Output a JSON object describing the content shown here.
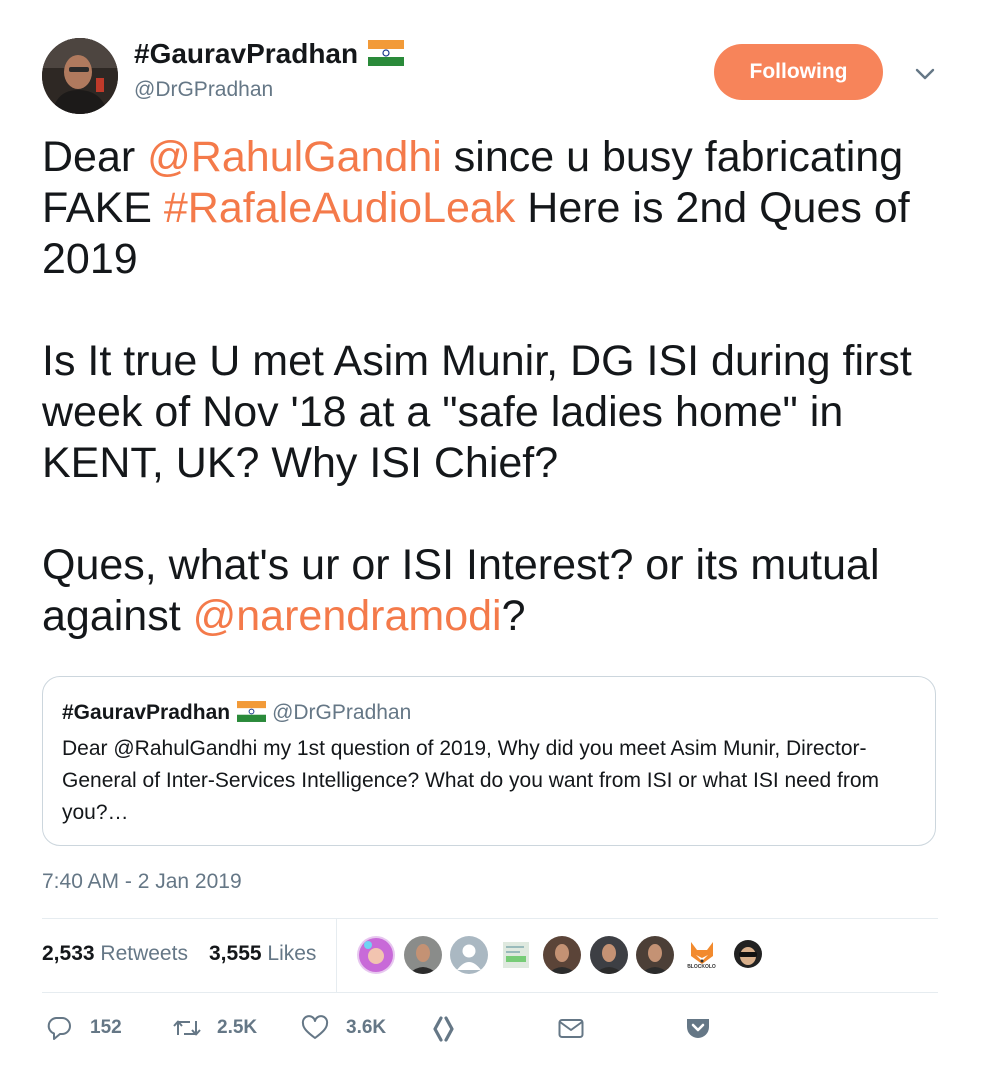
{
  "author": {
    "name": "#GauravPradhan",
    "handle": "@DrGPradhan",
    "flag_icon": "india-flag-icon"
  },
  "follow_button": {
    "label": "Following",
    "color": "#f7845a"
  },
  "menu_icon": "chevron-down-icon",
  "tweet": {
    "paragraphs": [
      [
        {
          "text": "Dear "
        },
        {
          "text": "@RahulGandhi",
          "link": true
        },
        {
          "text": " since u busy fabricating FAKE "
        },
        {
          "text": "#RafaleAudioLeak",
          "link": true
        },
        {
          "text": " Here is 2nd Ques of 2019"
        }
      ],
      [
        {
          "text": "Is It true U met Asim Munir, DG ISI during first week of Nov '18 at a \"safe ladies home\" in KENT, UK? Why ISI Chief?"
        }
      ],
      [
        {
          "text": "Ques, what's ur or ISI Interest? or its mutual against "
        },
        {
          "text": "@narendramodi",
          "link": true
        },
        {
          "text": "?"
        }
      ]
    ],
    "link_color": "#f47a4a"
  },
  "quoted_tweet": {
    "name": "#GauravPradhan",
    "handle": "@DrGPradhan",
    "text": "Dear @RahulGandhi my 1st question of 2019, Why did you meet Asim Munir, Director-General of Inter-Services Intelligence? What do you want from ISI or what ISI need from you?…"
  },
  "timestamp": "7:40 AM - 2 Jan 2019",
  "stats": {
    "retweets_count": "2,533",
    "retweets_label": "Retweets",
    "likes_count": "3,555",
    "likes_label": "Likes"
  },
  "likers": [
    {
      "name": "liker-avatar-1",
      "color": "#c86ad8"
    },
    {
      "name": "liker-avatar-2",
      "color": "#8a8c8a"
    },
    {
      "name": "liker-avatar-default",
      "color": "#aab8c2"
    },
    {
      "name": "liker-avatar-4",
      "color": "#dfe9df"
    },
    {
      "name": "liker-avatar-5",
      "color": "#5b4438"
    },
    {
      "name": "liker-avatar-6",
      "color": "#3d3f44"
    },
    {
      "name": "liker-avatar-7",
      "color": "#4c3f37"
    },
    {
      "name": "liker-avatar-fox",
      "color": "#f28a2e",
      "caption": "BLOCKOLO"
    },
    {
      "name": "liker-avatar-9",
      "color": "#222222"
    }
  ],
  "actions": {
    "reply_count": "152",
    "retweet_count": "2.5K",
    "like_count": "3.6K",
    "icons": [
      "reply-icon",
      "retweet-icon",
      "like-icon",
      "moments-icon",
      "direct-message-icon",
      "pocket-icon"
    ]
  }
}
